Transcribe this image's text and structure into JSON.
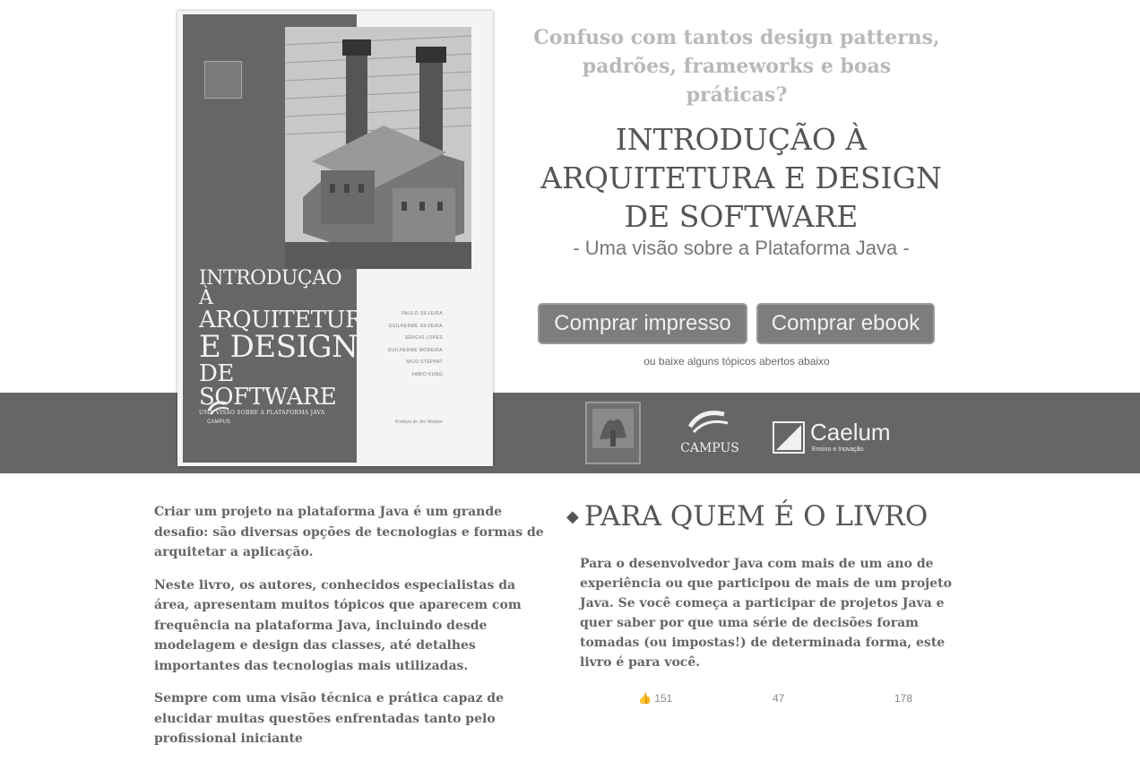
{
  "hero": {
    "tagline_line1": "Confuso com tantos design patterns,",
    "tagline_line2": "padrões, frameworks e boas práticas?",
    "title_line1": "INTRODUÇÃO À",
    "title_line2": "ARQUITETURA E DESIGN",
    "title_line3": "DE SOFTWARE",
    "subtitle": "- Uma visão sobre a Plataforma Java -",
    "buy_print_label": "Comprar impresso",
    "buy_ebook_label": "Comprar ebook",
    "hint": "ou baixe alguns tópicos abertos abaixo"
  },
  "book_cover": {
    "title_line1": "INTRODUÇÃO À",
    "title_line2": "ARQUITETURA",
    "title_line3": "E DESIGN",
    "title_line4": "DE SOFTWARE",
    "subtitle": "UMA VISÃO SOBRE A PLATAFORMA JAVA",
    "authors": [
      "PAULO SILVEIRA",
      "GUILHERME SILVEIRA",
      "SÉRGIO LOPES",
      "GUILHERME MOREIRA",
      "NICO STEPPAT",
      "FABIO KUNG"
    ],
    "foreword": "Prefácio de Jim Webber",
    "publisher": "CAMPUS"
  },
  "partners": {
    "elsevier": "ELSEVIER",
    "campus": "CAMPUS",
    "caelum": "Caelum",
    "caelum_sub": "Ensino e Inovação"
  },
  "content": {
    "paragraphs": [
      "Criar um projeto na plataforma Java é um grande desafio: são diversas opções de tecnologias e formas de arquitetar a aplicação.",
      "Neste livro, os autores, conhecidos especialistas da área, apresentam muitos tópicos que aparecem com frequência na plataforma Java, incluindo desde modelagem e design das classes, até detalhes importantes das tecnologias mais utilizadas.",
      "Sempre com uma visão técnica e prática capaz de elucidar muitas questões enfrentadas tanto pelo profissional iniciante"
    ],
    "section_title": "PARA QUEM É O LIVRO",
    "section_body": "Para o desenvolvedor Java com mais de um ano de experiência ou que participou de mais de um projeto Java. Se você começa a participar de projetos Java e quer saber por que uma série de decisões foram tomadas (ou impostas!) de determinada forma, este livro é para você."
  },
  "social": {
    "likes": "151",
    "shares": "47",
    "tweets": "178"
  }
}
